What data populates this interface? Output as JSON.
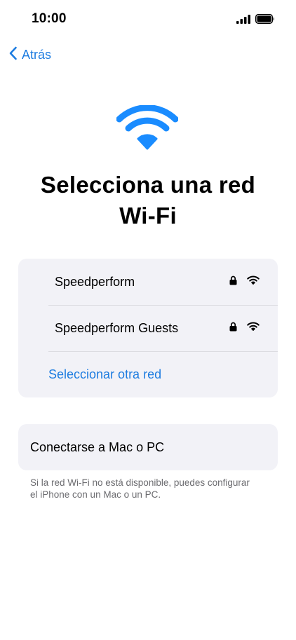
{
  "status_bar": {
    "time": "10:00",
    "icons": [
      "cellular-signal-icon",
      "battery-icon"
    ]
  },
  "nav": {
    "back_label": "Atrás",
    "back_icon": "chevron-left-icon"
  },
  "hero": {
    "icon": "wifi-icon",
    "title_line1": "Selecciona una red",
    "title_line2": "Wi-Fi"
  },
  "networks": {
    "items": [
      {
        "name": "Speedperform",
        "icons": [
          "lock-icon",
          "wifi-signal-icon"
        ]
      },
      {
        "name": "Speedperform Guests",
        "icons": [
          "lock-icon",
          "wifi-signal-icon"
        ]
      }
    ],
    "other_label": "Seleccionar otra red"
  },
  "computer": {
    "label": "Conectarse a Mac o PC",
    "note": "Si la red Wi-Fi no está disponible, puedes configurar el iPhone con un Mac o un PC."
  },
  "colors": {
    "accent": "#1d7ce0",
    "wifi_hero": "#1a8cff",
    "card_bg": "#f2f2f7",
    "secondary_text": "#6c6c70"
  }
}
